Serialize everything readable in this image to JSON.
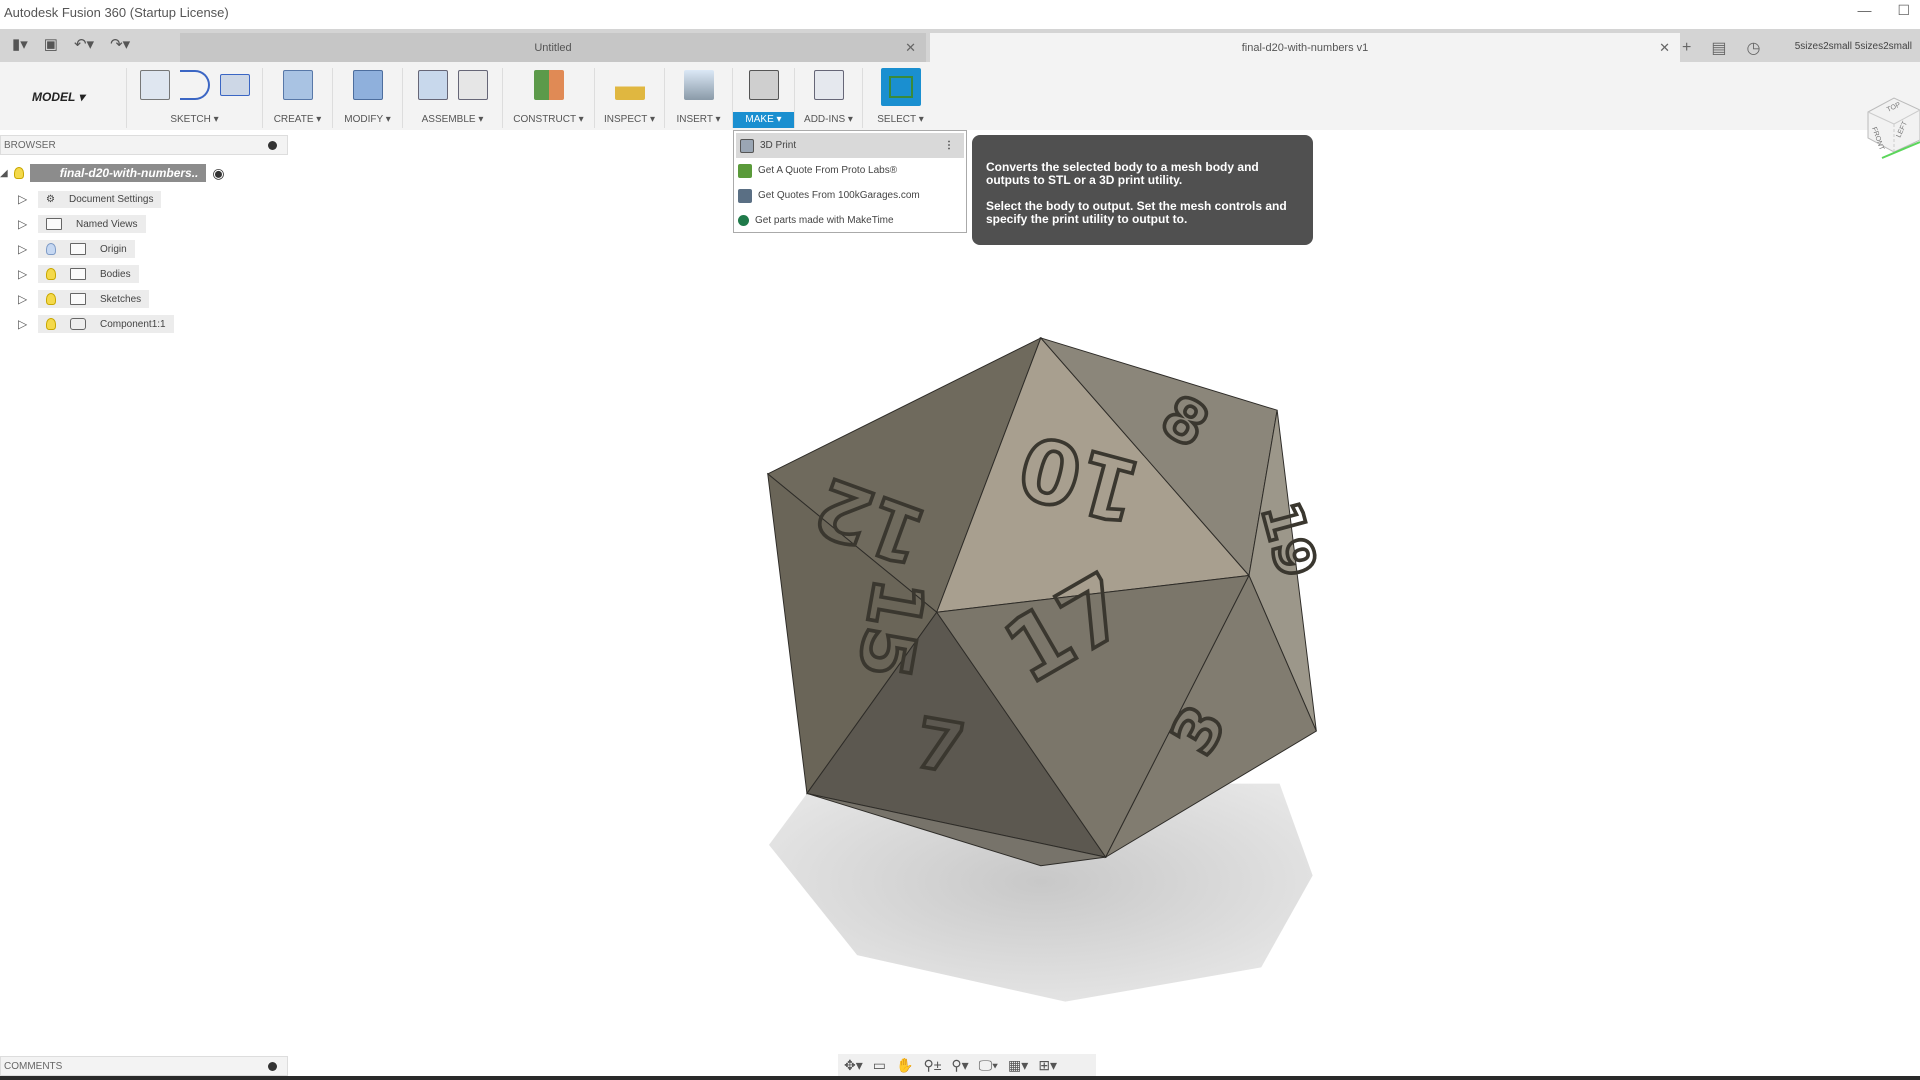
{
  "app_title": "Autodesk Fusion 360 (Startup License)",
  "tabs": [
    {
      "label": "Untitled"
    },
    {
      "label": "final-d20-with-numbers v1"
    }
  ],
  "user": "5sizes2small 5sizes2small",
  "workspace": "MODEL ▾",
  "toolbar": [
    {
      "label": "SKETCH ▾"
    },
    {
      "label": "CREATE ▾"
    },
    {
      "label": "MODIFY ▾"
    },
    {
      "label": "ASSEMBLE ▾"
    },
    {
      "label": "CONSTRUCT ▾"
    },
    {
      "label": "INSPECT ▾"
    },
    {
      "label": "INSERT ▾"
    },
    {
      "label": "MAKE ▾"
    },
    {
      "label": "ADD-INS ▾"
    },
    {
      "label": "SELECT ▾"
    }
  ],
  "browser": {
    "title": "BROWSER",
    "root": "final-d20-with-numbers..",
    "items": [
      {
        "label": "Document Settings"
      },
      {
        "label": "Named Views"
      },
      {
        "label": "Origin"
      },
      {
        "label": "Bodies"
      },
      {
        "label": "Sketches"
      },
      {
        "label": "Component1:1"
      }
    ]
  },
  "make_menu": [
    {
      "label": "3D Print"
    },
    {
      "label": "Get A Quote From Proto Labs®"
    },
    {
      "label": "Get Quotes From 100kGarages.com"
    },
    {
      "label": "Get parts made with MakeTime"
    }
  ],
  "tooltip": {
    "line1": "Converts the selected body to a mesh body and outputs to STL or a 3D print utility.",
    "line2": "Select the body to output. Set the mesh controls and specify the print utility to output to."
  },
  "die_numbers": [
    "12",
    "10",
    "8",
    "19",
    "15",
    "17",
    "7",
    "3"
  ],
  "viewcube": {
    "faces": [
      "TOP",
      "FRONT",
      "LEFT"
    ]
  },
  "comments": {
    "title": "COMMENTS"
  },
  "colors": {
    "accent": "#1a8fd0",
    "tooltip_bg": "#505050"
  }
}
